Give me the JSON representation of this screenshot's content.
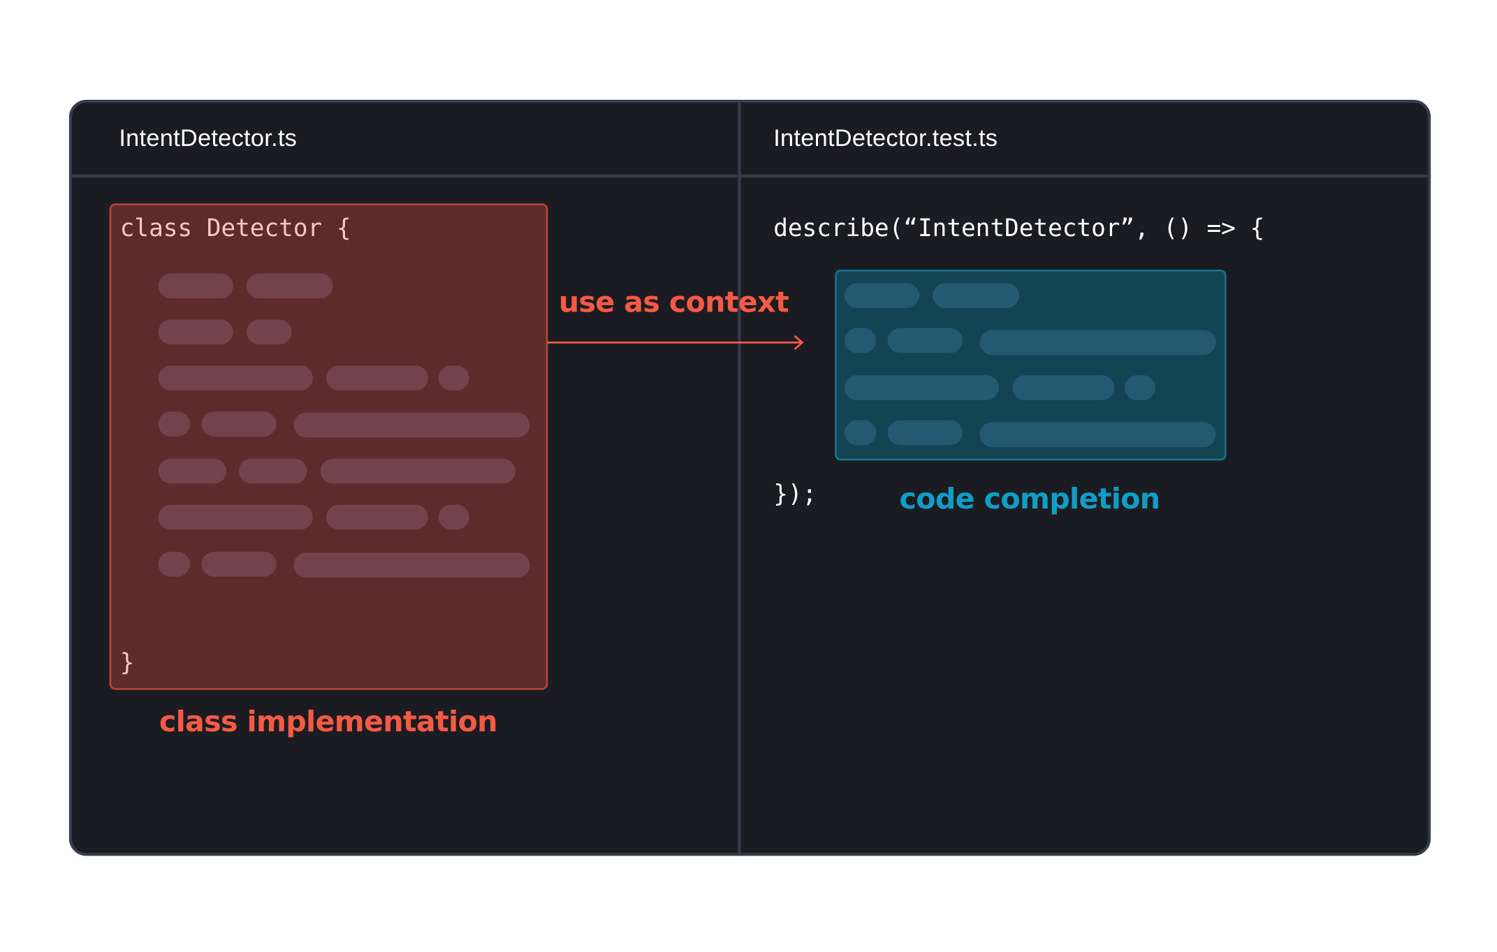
{
  "colors": {
    "background": "#1b1c21",
    "border": "#363c4c",
    "context_accent": "#f55a45",
    "completion_accent": "#109ec6",
    "code_text_left": "#f7c8be",
    "code_text_right": "#ffffff"
  },
  "left_pane": {
    "tab_title": "IntentDetector.ts",
    "code_open": "class Detector {",
    "code_close": "}",
    "placeholder_lines": 7,
    "caption": "class implementation"
  },
  "arrow": {
    "label": "use as context"
  },
  "right_pane": {
    "tab_title": "IntentDetector.test.ts",
    "code_open": "describe(“IntentDetector”, () => {",
    "code_close": "});",
    "placeholder_lines": 4,
    "caption": "code completion"
  }
}
